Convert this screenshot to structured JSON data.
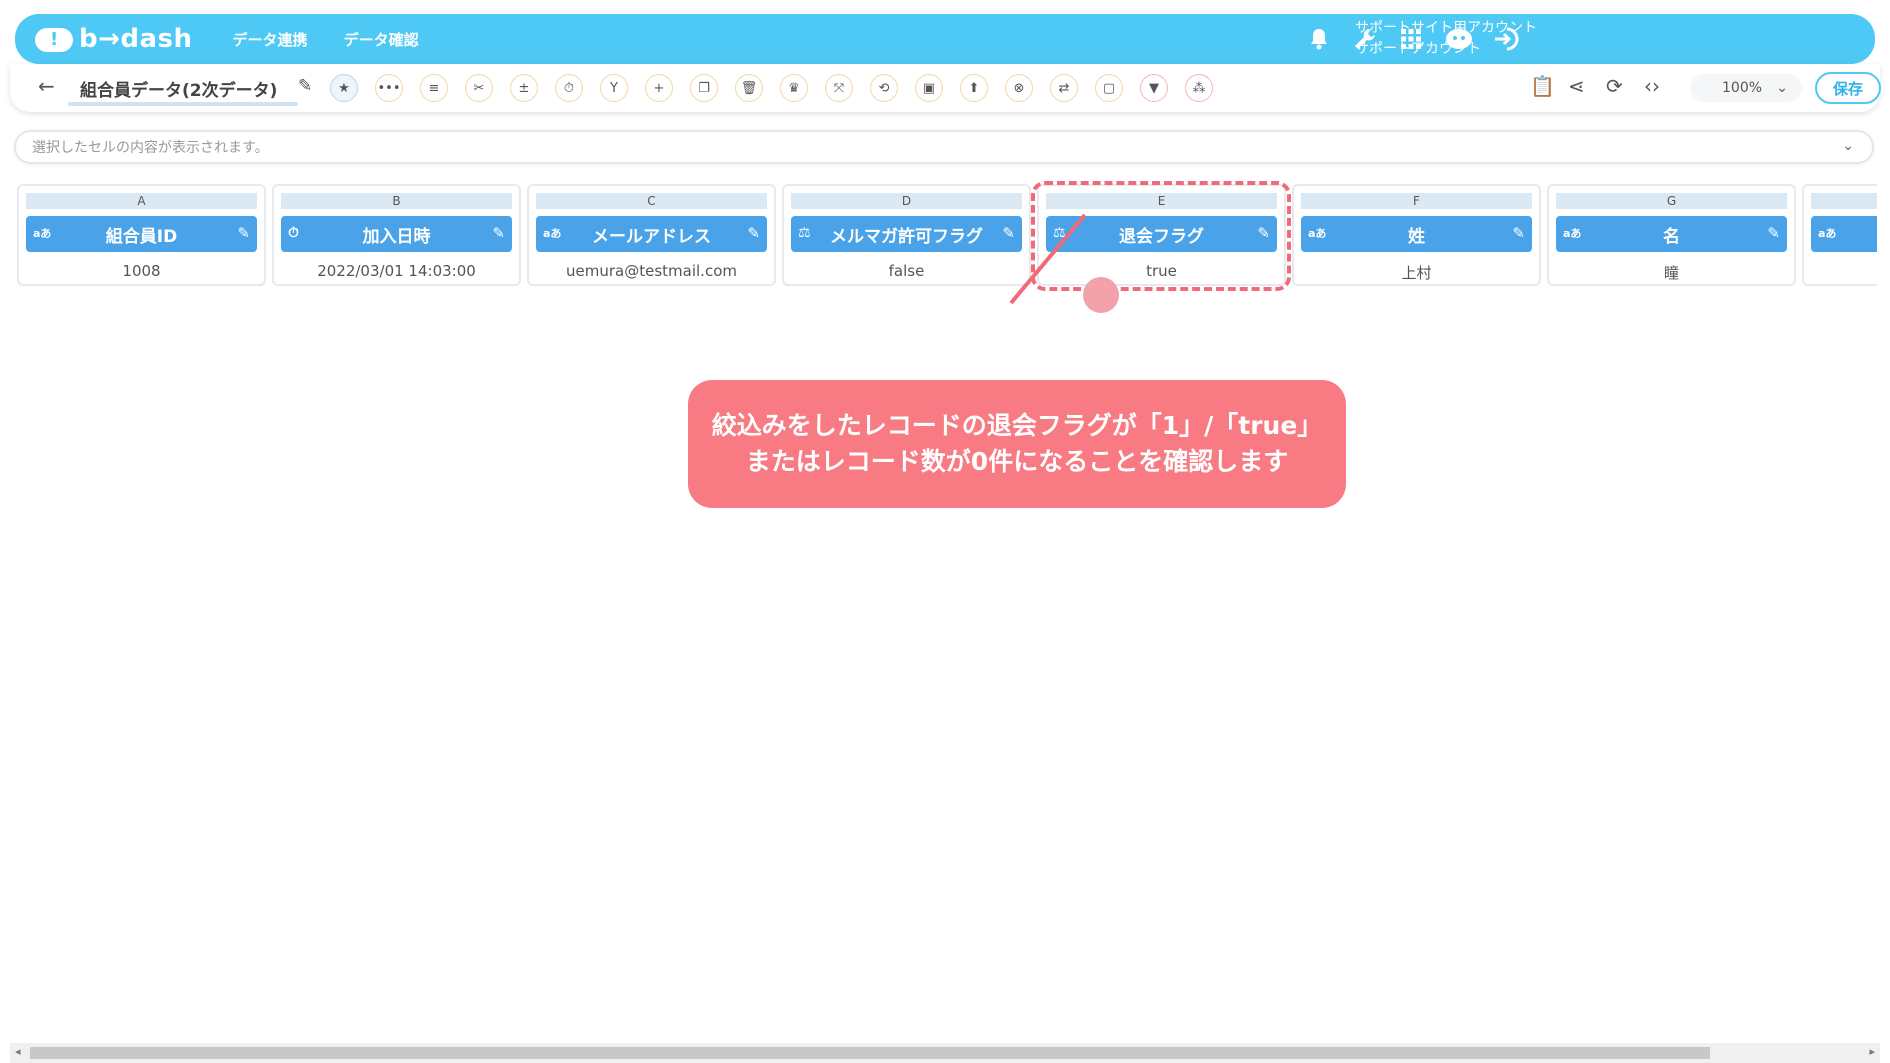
{
  "header": {
    "logo_text": "b→dash",
    "nav": [
      "データ連携",
      "データ確認"
    ],
    "account_line1": "サポートサイト用アカウント",
    "account_line2": "サポートアカウント"
  },
  "toolbar": {
    "title": "組合員データ(2次データ)",
    "zoom": "100%",
    "save_label": "保存"
  },
  "cell_bar": {
    "placeholder": "選択したセルの内容が表示されます。"
  },
  "columns": [
    {
      "letter": "A",
      "type": "aあ",
      "name": "組合員ID",
      "value": "1008"
    },
    {
      "letter": "B",
      "type": "⏱",
      "name": "加入日時",
      "value": "2022/03/01 14:03:00"
    },
    {
      "letter": "C",
      "type": "aあ",
      "name": "メールアドレス",
      "value": "uemura@testmail.com"
    },
    {
      "letter": "D",
      "type": "⚖",
      "name": "メルマガ許可フラグ",
      "value": "false"
    },
    {
      "letter": "E",
      "type": "⚖",
      "name": "退会フラグ",
      "value": "true"
    },
    {
      "letter": "F",
      "type": "aあ",
      "name": "姓",
      "value": "上村"
    },
    {
      "letter": "G",
      "type": "aあ",
      "name": "名",
      "value": "瞳"
    },
    {
      "letter": "",
      "type": "aあ",
      "name": "",
      "value": ""
    }
  ],
  "callout": {
    "line1": "絞込みをしたレコードの退会フラグが「1」/「true」",
    "line2": "またはレコード数が0件になることを確認します"
  },
  "colors": {
    "header": "#4ec9f5",
    "column_header": "#4aa3e8",
    "callout": "#f87a83",
    "highlight": "#f06a78"
  }
}
